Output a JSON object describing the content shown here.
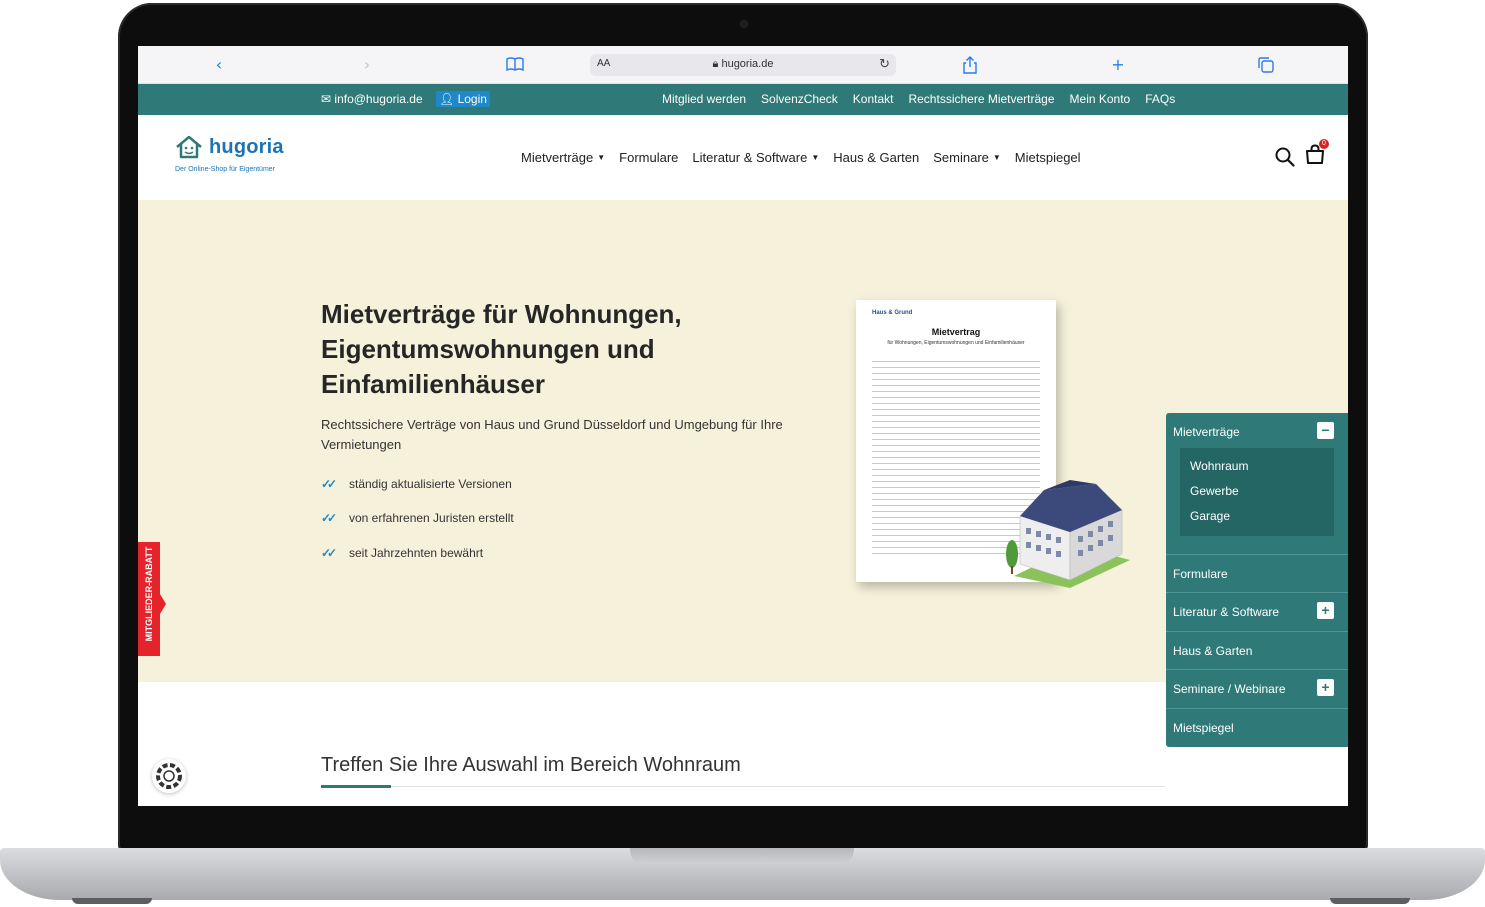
{
  "browser": {
    "url": "hugoria.de",
    "aa_label": "AA"
  },
  "topbar": {
    "email": "info@hugoria.de",
    "login": "Login",
    "links": [
      "Mitglied werden",
      "SolvenzCheck",
      "Kontakt",
      "Rechtssichere Mietverträge",
      "Mein Konto",
      "FAQs"
    ]
  },
  "header": {
    "logo_name": "hugoria",
    "logo_tagline": "Der Online-Shop für Eigentümer",
    "nav": [
      {
        "label": "Mietverträge",
        "dropdown": true
      },
      {
        "label": "Formulare",
        "dropdown": false
      },
      {
        "label": "Literatur & Software",
        "dropdown": true
      },
      {
        "label": "Haus & Garten",
        "dropdown": false
      },
      {
        "label": "Seminare",
        "dropdown": true
      },
      {
        "label": "Mietspiegel",
        "dropdown": false
      }
    ],
    "cart_count": "0"
  },
  "hero": {
    "title": "Mietverträge für Wohnungen, Eigentumswohnungen und Einfamilienhäuser",
    "subtitle": "Rechtssichere Verträge von Haus und Grund Düsseldorf und Umgebung für Ihre Vermietungen",
    "features": [
      "ständig aktualisierte Versionen",
      "von erfahrenen Juristen erstellt",
      "seit Jahrzehnten bewährt"
    ],
    "side_badge": "MITGLIEDER-RABATT",
    "doc_title": "Mietvertrag",
    "doc_subtitle": "für Wohnungen, Eigentumswohnungen und Einfamilienhäuser",
    "doc_logo": "Haus & Grund"
  },
  "sidemenu": {
    "items": [
      {
        "label": "Mietverträge",
        "toggle": "−"
      },
      {
        "label": "Formulare",
        "toggle": ""
      },
      {
        "label": "Literatur & Software",
        "toggle": "+"
      },
      {
        "label": "Haus & Garten",
        "toggle": ""
      },
      {
        "label": "Seminare / Webinare",
        "toggle": "+"
      },
      {
        "label": "Mietspiegel",
        "toggle": ""
      }
    ],
    "sub_items": [
      "Wohnraum",
      "Gewerbe",
      "Garage"
    ]
  },
  "section": {
    "title": "Treffen Sie Ihre Auswahl im Bereich Wohnraum"
  },
  "colors": {
    "teal": "#2f7a78",
    "brand_blue": "#1d74b5",
    "hero_bg": "#f5f1da",
    "badge_red": "#e3242b"
  }
}
